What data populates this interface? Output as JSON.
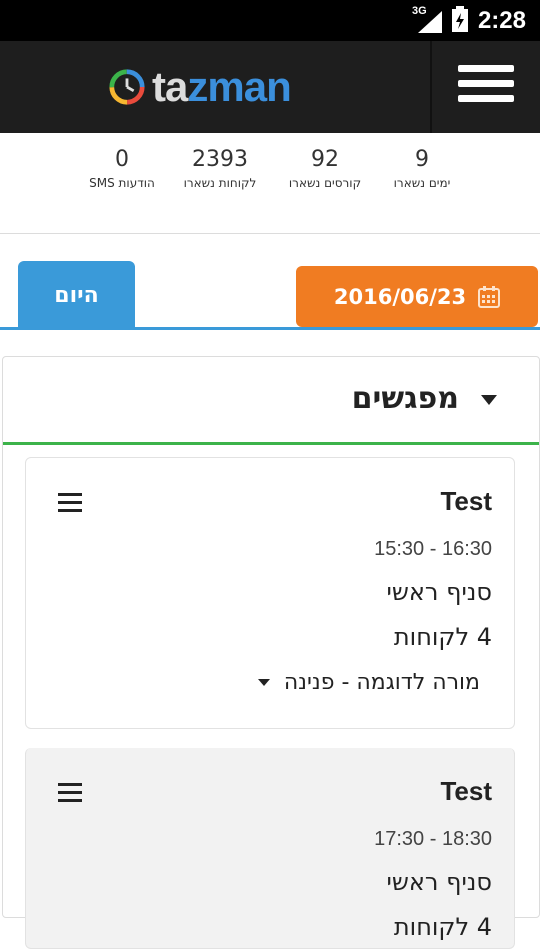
{
  "status": {
    "network": "3G",
    "time": "2:28"
  },
  "brand": {
    "logo_ta": "ta",
    "logo_zman": "zman"
  },
  "stats": [
    {
      "value": "9",
      "label": "ימים נשארו"
    },
    {
      "value": "92",
      "label": "קורסים נשארו"
    },
    {
      "value": "2393",
      "label": "לקוחות נשארו"
    },
    {
      "value": "0",
      "label": "הודעות SMS"
    }
  ],
  "toolbar": {
    "today_label": "היום",
    "date_value": "2016/06/23"
  },
  "section": {
    "title": "מפגשים"
  },
  "meetings": [
    {
      "title": "Test",
      "time": "15:30 - 16:30",
      "branch": "סניף ראשי",
      "clients": "4 לקוחות",
      "teacher": "מורה לדוגמה - פנינה"
    },
    {
      "title": "Test",
      "time": "17:30 - 18:30",
      "branch": "סניף ראשי",
      "clients": "4 לקוחות"
    }
  ],
  "colors": {
    "accent_blue": "#3a9ad9",
    "accent_orange": "#f07c22",
    "accent_green": "#3cb34a",
    "appbar": "#1e1e1e"
  }
}
